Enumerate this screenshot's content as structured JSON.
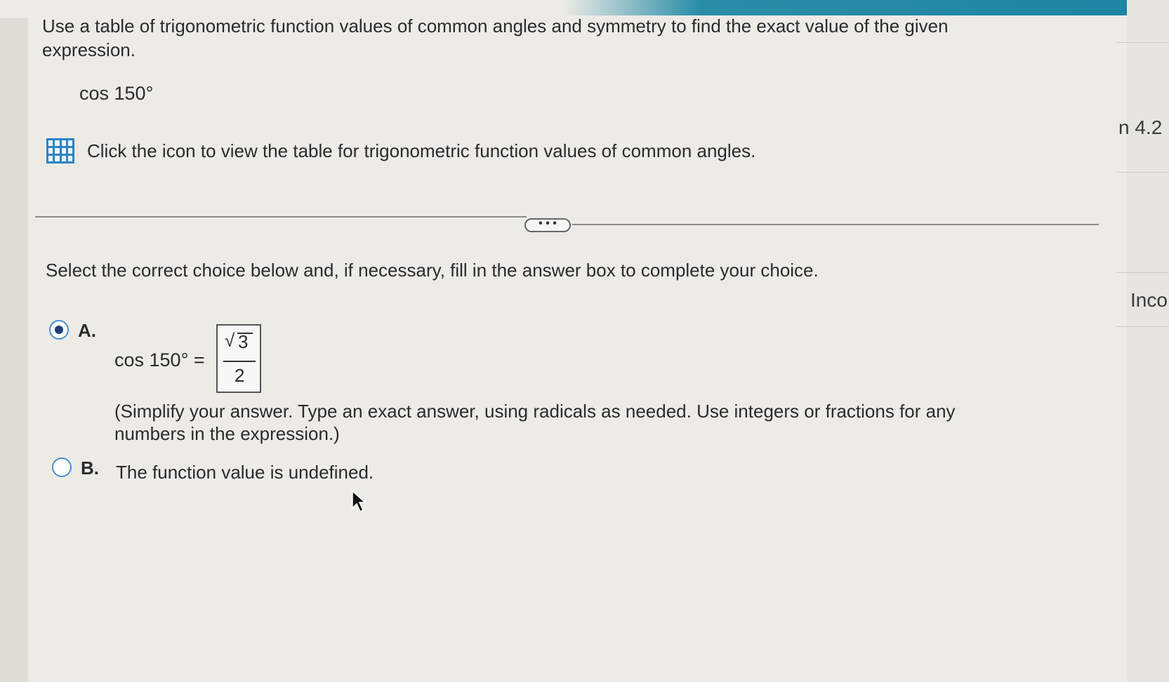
{
  "question": {
    "text": "Use a table of trigonometric function values of common angles and symmetry to find the exact value of the given expression.",
    "expression": "cos 150°",
    "hint": "Click the icon to view the table for trigonometric function values of common angles."
  },
  "more_button_label": "• • •",
  "instruction": "Select the correct choice below and, if necessary, fill in the answer box to complete your choice.",
  "choices": {
    "a": {
      "label": "A.",
      "selected": true,
      "equation_left": "cos 150° =",
      "answer": {
        "radicand": "3",
        "radical_symbol": "√",
        "denominator": "2"
      },
      "note": "(Simplify your answer. Type an exact answer, using radicals as needed. Use integers or fractions for any numbers in the expression.)"
    },
    "b": {
      "label": "B.",
      "selected": false,
      "text": "The function value is undefined."
    }
  },
  "side_panel": {
    "section": "n 4.2",
    "status": "Inco"
  },
  "colors": {
    "accent_bar": "#1d86a4",
    "icon_blue": "#2a84c4",
    "radio_fill": "#1f3f7a"
  }
}
